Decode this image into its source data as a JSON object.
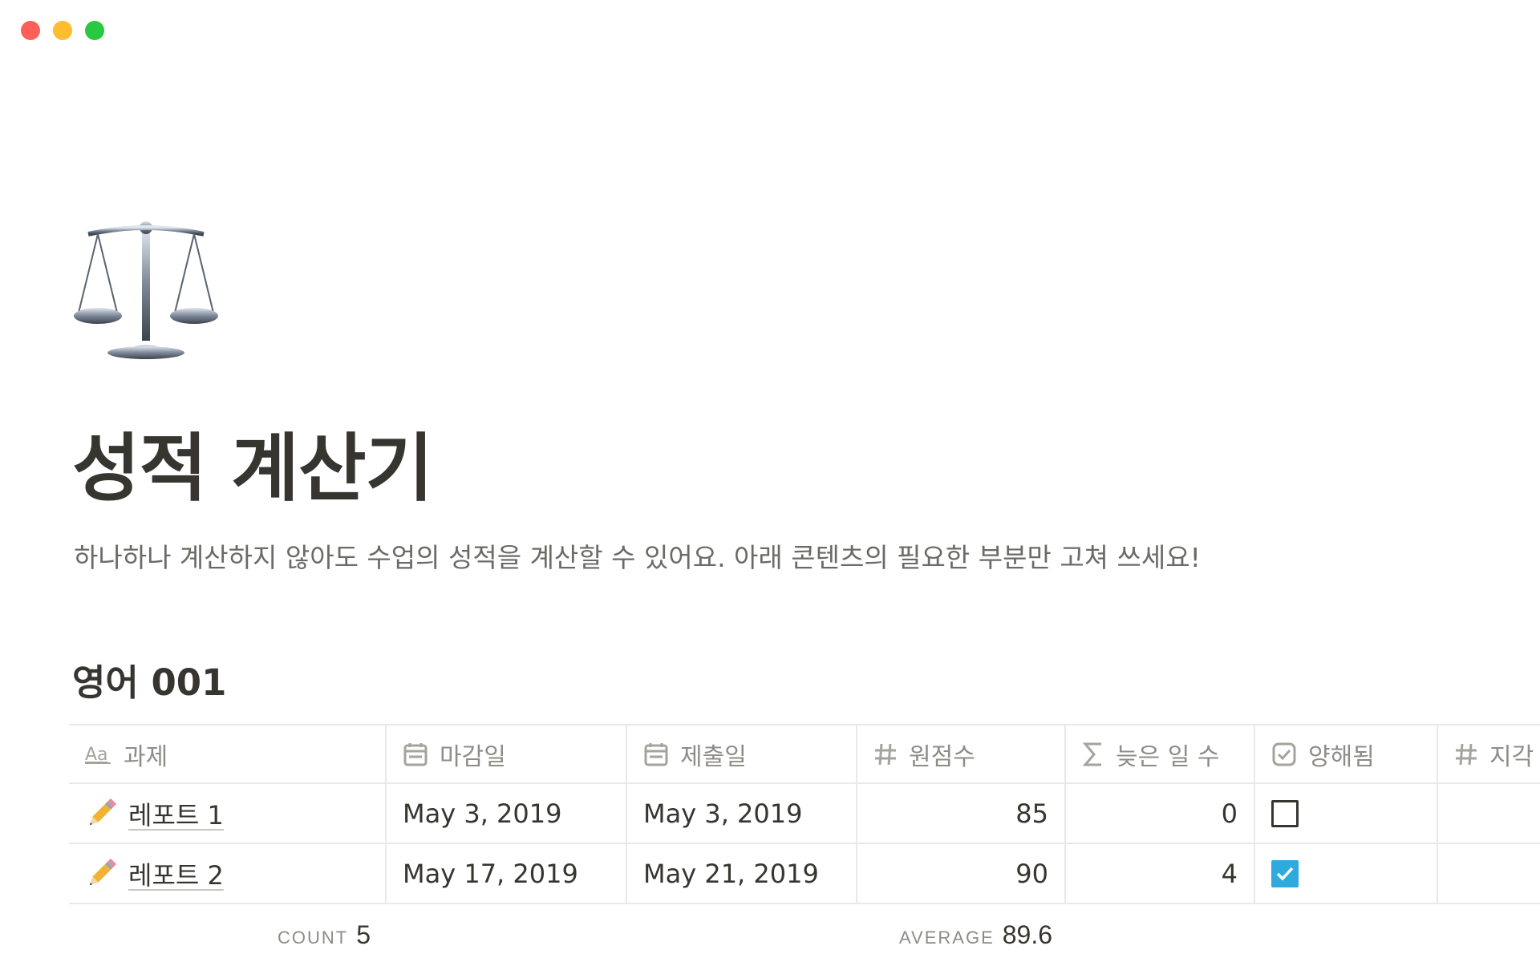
{
  "page": {
    "icon": "balance-scale-icon",
    "title": "성적 계산기",
    "description": "하나하나 계산하지 않아도 수업의 성적을 계산할 수 있어요. 아래 콘텐츠의 필요한 부분만 고쳐 쓰세요!"
  },
  "database": {
    "title": "영어 001",
    "columns": [
      {
        "label": "과제",
        "icon": "text-property-icon"
      },
      {
        "label": "마감일",
        "icon": "calendar-icon"
      },
      {
        "label": "제출일",
        "icon": "calendar-icon"
      },
      {
        "label": "원점수",
        "icon": "number-icon"
      },
      {
        "label": "늦은 일 수",
        "icon": "formula-sigma-icon"
      },
      {
        "label": "양해됨",
        "icon": "checkbox-property-icon"
      },
      {
        "label": "지각",
        "icon": "number-icon"
      }
    ],
    "rows": [
      {
        "icon": "pencil-icon",
        "title": "레포트 1",
        "due": "May 3, 2019",
        "submitted": "May 3, 2019",
        "raw_score": "85",
        "days_late": "0",
        "excused": false,
        "late": ""
      },
      {
        "icon": "pencil-icon",
        "title": "레포트 2",
        "due": "May 17, 2019",
        "submitted": "May 21, 2019",
        "raw_score": "90",
        "days_late": "4",
        "excused": true,
        "late": ""
      }
    ],
    "footer": {
      "count_label": "COUNT",
      "count_value": "5",
      "average_label": "AVERAGE",
      "average_value": "89.6"
    }
  },
  "colors": {
    "accent_checkbox": "#2eaadc",
    "text": "#37352f",
    "muted": "#8e8c87",
    "border": "#e9e9e7"
  }
}
